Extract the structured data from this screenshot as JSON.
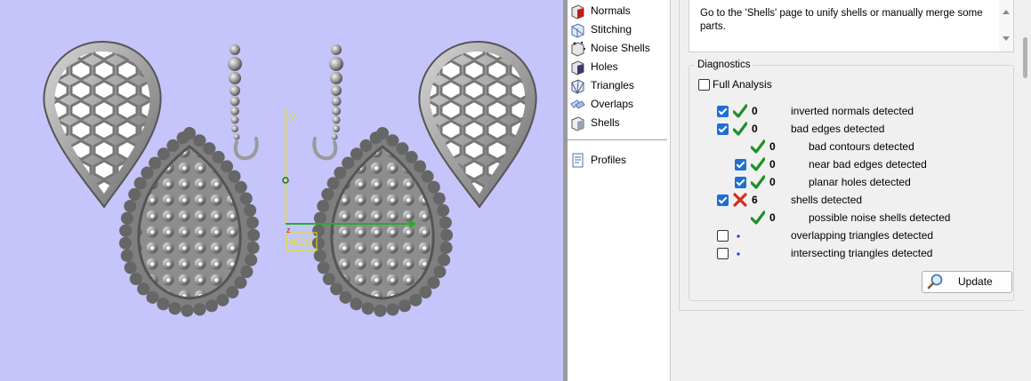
{
  "viewport": {
    "axis_y_label": "y",
    "axis_z_label": "z",
    "wcs_label": "WCS",
    "colors": {
      "background": "#c5c5fb",
      "model": "#a8a8a8",
      "axis_y": "#e0e000",
      "axis_x": "#22aa22"
    }
  },
  "nav": {
    "items": [
      {
        "label": "Normals",
        "icon": "normals-icon"
      },
      {
        "label": "Stitching",
        "icon": "stitching-icon"
      },
      {
        "label": "Noise Shells",
        "icon": "noise-shells-icon"
      },
      {
        "label": "Holes",
        "icon": "holes-icon"
      },
      {
        "label": "Triangles",
        "icon": "triangles-icon"
      },
      {
        "label": "Overlaps",
        "icon": "overlaps-icon"
      },
      {
        "label": "Shells",
        "icon": "shells-icon"
      },
      {
        "label": "Profiles",
        "icon": "profiles-icon"
      }
    ]
  },
  "message": {
    "text": "Go to the 'Shells' page to unify shells or manually merge some parts."
  },
  "diagnostics": {
    "title": "Diagnostics",
    "full_analysis_label": "Full Analysis",
    "full_analysis_checked": false,
    "rows": [
      {
        "checkbox": true,
        "checked": true,
        "status": "ok",
        "count": "0",
        "label": "inverted normals detected",
        "indent": 0
      },
      {
        "checkbox": true,
        "checked": true,
        "status": "ok",
        "count": "0",
        "label": "bad edges detected",
        "indent": 0
      },
      {
        "checkbox": false,
        "checked": false,
        "status": "ok",
        "count": "0",
        "label": "bad contours detected",
        "indent": 1
      },
      {
        "checkbox": true,
        "checked": true,
        "status": "ok",
        "count": "0",
        "label": "near bad edges detected",
        "indent": 1
      },
      {
        "checkbox": true,
        "checked": true,
        "status": "ok",
        "count": "0",
        "label": "planar holes detected",
        "indent": 1
      },
      {
        "checkbox": true,
        "checked": true,
        "status": "error",
        "count": "6",
        "label": "shells detected",
        "indent": 0
      },
      {
        "checkbox": false,
        "checked": false,
        "status": "ok",
        "count": "0",
        "label": "possible noise shells detected",
        "indent": 1
      },
      {
        "checkbox": true,
        "checked": false,
        "status": "pending",
        "count": "",
        "label": "overlapping triangles detected",
        "indent": 0
      },
      {
        "checkbox": true,
        "checked": false,
        "status": "pending",
        "count": "",
        "label": "intersecting triangles detected",
        "indent": 0
      }
    ],
    "update_label": "Update"
  }
}
